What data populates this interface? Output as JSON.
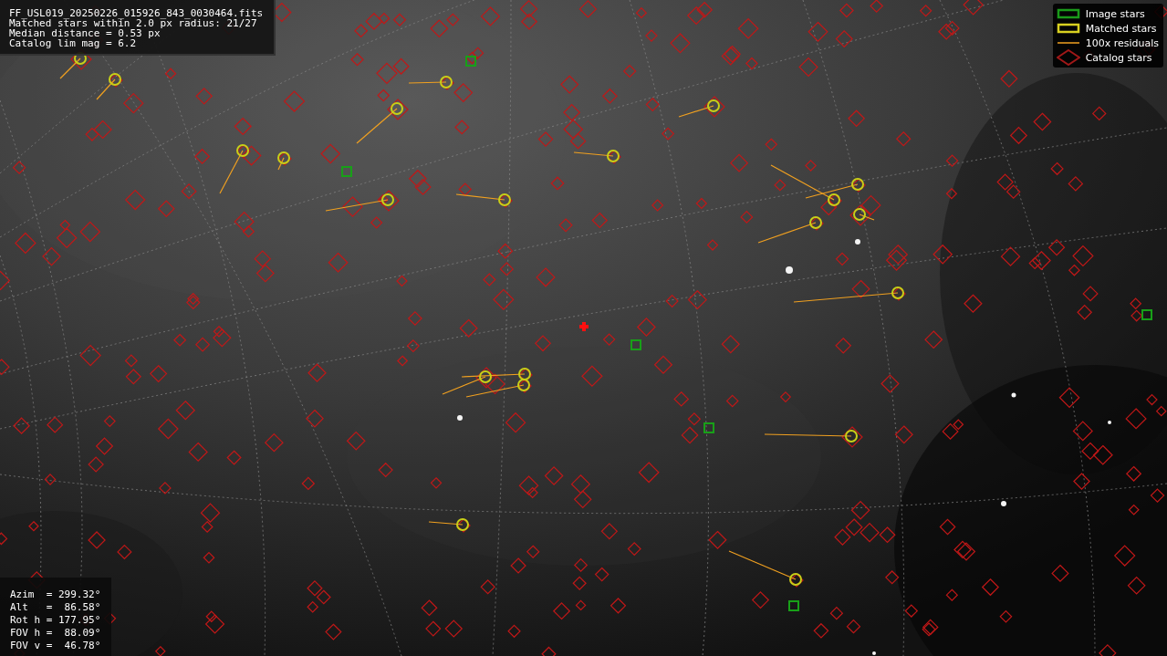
{
  "file_info": {
    "lines": [
      "FF_USL019_20250226_015926_843_0030464.fits",
      "Matched stars within 2.0 px radius: 21/27",
      "Median distance = 0.53 px",
      "Catalog lim mag = 6.2"
    ]
  },
  "legend": [
    {
      "label": "Image stars"
    },
    {
      "kind": "matched",
      "label": "Matched stars"
    },
    {
      "kind": "residual",
      "label": "100x residuals"
    },
    {
      "kind": "catalog",
      "label": "Catalog stars"
    }
  ],
  "pointing": {
    "lines": [
      "Azim  = 299.32°",
      "Alt   =  86.58°",
      "Rot h = 177.95°",
      "FOV h =  88.09°",
      "FOV v =  46.78°"
    ]
  }
}
